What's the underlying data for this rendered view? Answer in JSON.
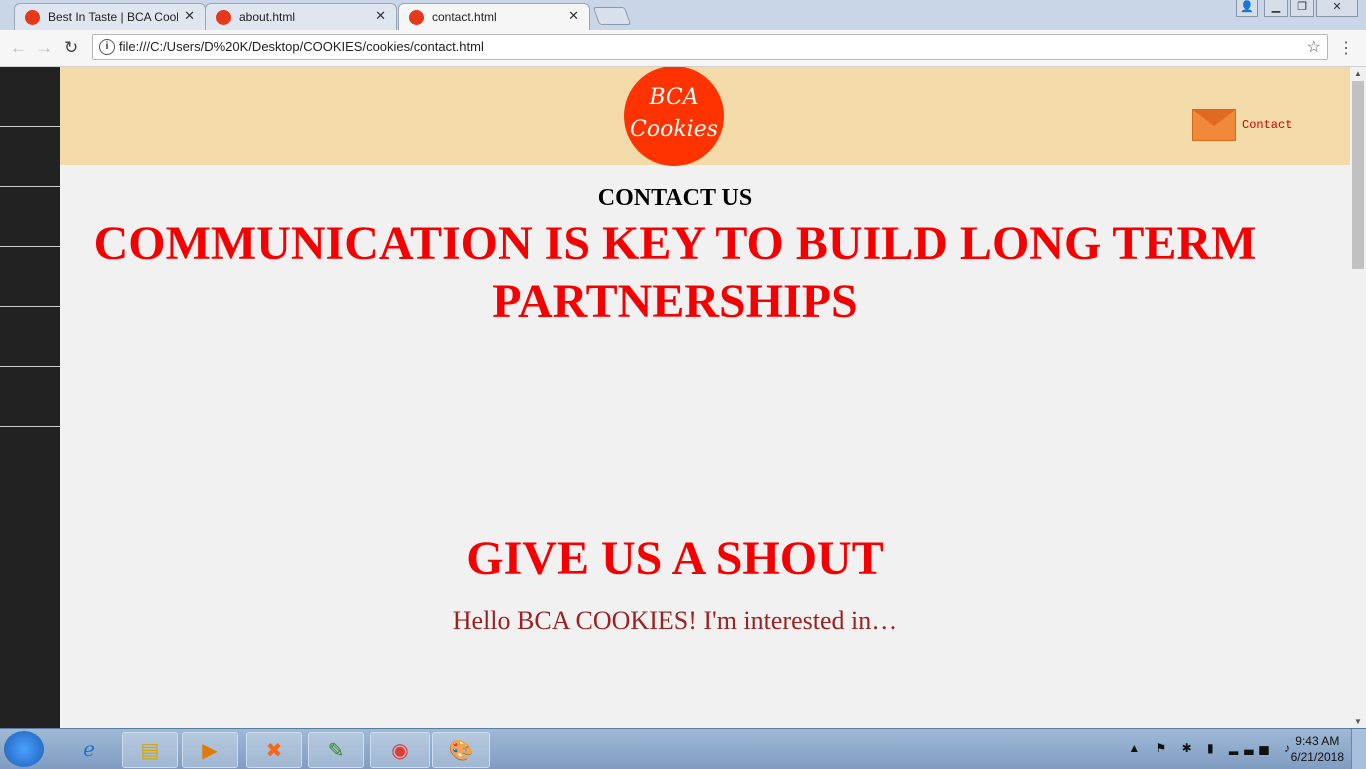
{
  "browser": {
    "tabs": [
      {
        "title": "Best In Taste | BCA Cooki"
      },
      {
        "title": "about.html"
      },
      {
        "title": "contact.html"
      }
    ],
    "url": "file:///C:/Users/D%20K/Desktop/COOKIES/cookies/contact.html"
  },
  "page": {
    "logo_line1": "BCA",
    "logo_line2": "Cookies",
    "contact_link": "Contact",
    "contact_heading": "CONTACT US",
    "headline": "COMMUNICATION IS KEY TO BUILD LONG TERM PARTNERSHIPS",
    "shout_heading": "GIVE US A SHOUT",
    "hello_text": "Hello BCA COOKIES! I'm interested in…"
  },
  "taskbar": {
    "time": "9:43 AM",
    "date": "6/21/2018"
  },
  "colors": {
    "header_bg": "#f3dba9",
    "logo_bg": "#ff3300",
    "heading_red": "#f50000",
    "sidebar_bg": "#222222"
  },
  "icons": [
    "ie-icon",
    "explorer-icon",
    "media-player-icon",
    "xampp-icon",
    "notepad-icon",
    "chrome-icon",
    "paint-icon"
  ]
}
